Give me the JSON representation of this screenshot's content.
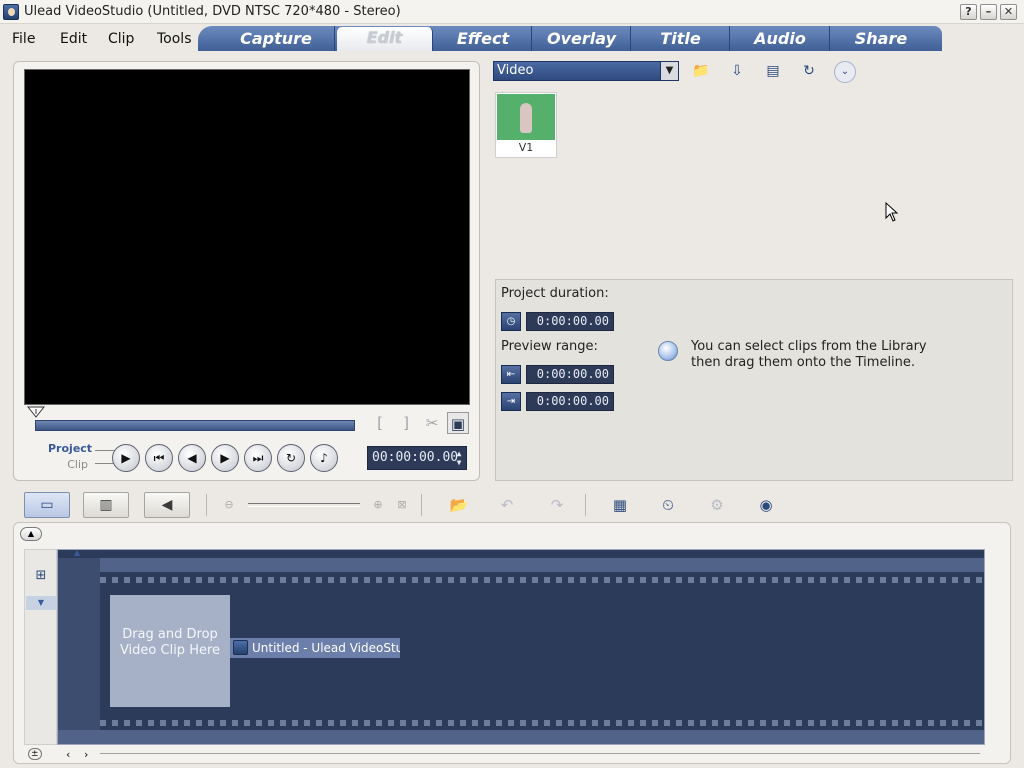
{
  "window": {
    "title": "Ulead VideoStudio (Untitled, DVD NTSC 720*480 - Stereo)",
    "help": "?",
    "minimize": "–",
    "close": "✕"
  },
  "menu": {
    "file": "File",
    "edit": "Edit",
    "clip": "Clip",
    "tools": "Tools"
  },
  "tabs": {
    "capture": "Capture",
    "edit": "Edit",
    "effect": "Effect",
    "overlay": "Overlay",
    "title": "Title",
    "audio": "Audio",
    "share": "Share",
    "active": "edit"
  },
  "preview": {
    "mode_project": "Project",
    "mode_clip": "Clip",
    "timecode": "00:00:00.00"
  },
  "library": {
    "dropdown_value": "Video",
    "clips": [
      {
        "label": "V1"
      }
    ]
  },
  "info": {
    "project_duration_label": "Project duration:",
    "project_duration": "0:00:00.00",
    "preview_range_label": "Preview range:",
    "range_start": "0:00:00.00",
    "range_end": "0:00:00.00",
    "tip": "You can select clips from the Library then drag them onto the Timeline."
  },
  "timeline": {
    "drop_text": "Drag and Drop Video Clip Here",
    "drag_label": "Untitled - Ulead VideoStudio"
  },
  "colors": {
    "tab_bar": "#4a6aa4",
    "timeline_bg": "#2d3b5b",
    "timecode_bg": "#2d3a58"
  }
}
